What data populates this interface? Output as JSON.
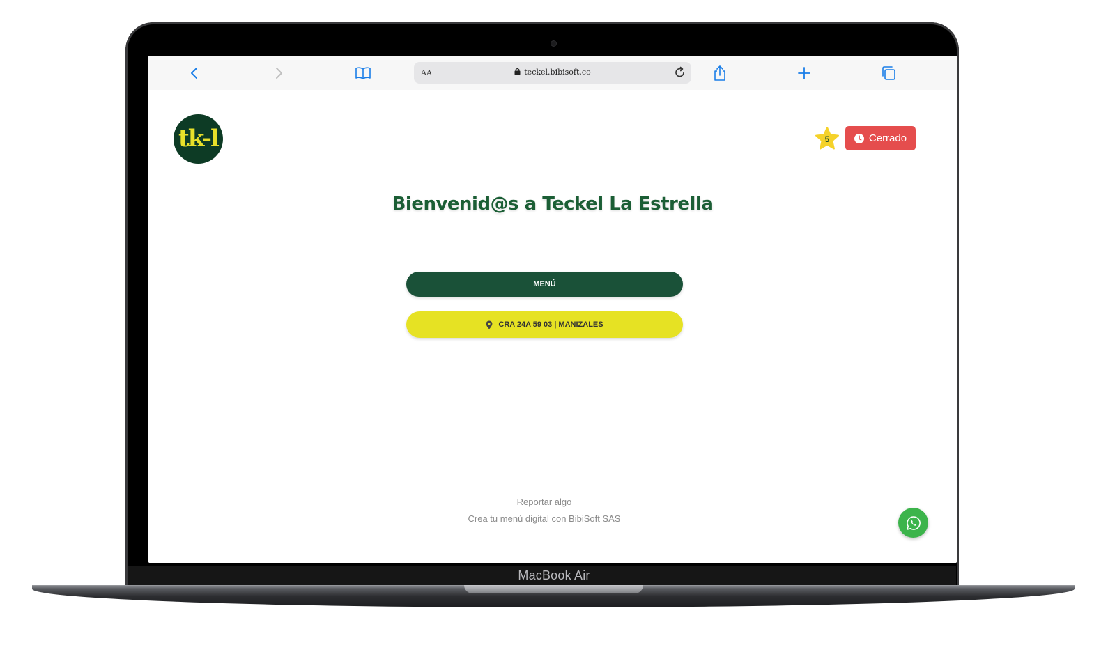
{
  "device": {
    "label": "MacBook Air"
  },
  "browser": {
    "text_size_label": "AA",
    "url": "teckel.bibisoft.co"
  },
  "site": {
    "logo_text": "tk-l",
    "rating": "5",
    "status": "Cerrado",
    "welcome": "Bienvenid@s a Teckel La Estrella",
    "menu_button": "MENÚ",
    "address_button": "CRA 24A 59 03 | MANIZALES",
    "report_link": "Reportar algo",
    "credit": "Crea tu menú digital con BibiSoft SAS"
  },
  "colors": {
    "brand_green": "#1a5138",
    "brand_yellow": "#e6e223",
    "status_red": "#e54d4d",
    "whatsapp_green": "#3cb44b",
    "safari_blue": "#1a7ee8"
  },
  "icons": [
    "back-icon",
    "forward-icon",
    "bookmarks-icon",
    "lock-icon",
    "reload-icon",
    "share-icon",
    "new-tab-icon",
    "tabs-icon",
    "star-icon",
    "clock-icon",
    "location-pin-icon",
    "whatsapp-icon"
  ]
}
